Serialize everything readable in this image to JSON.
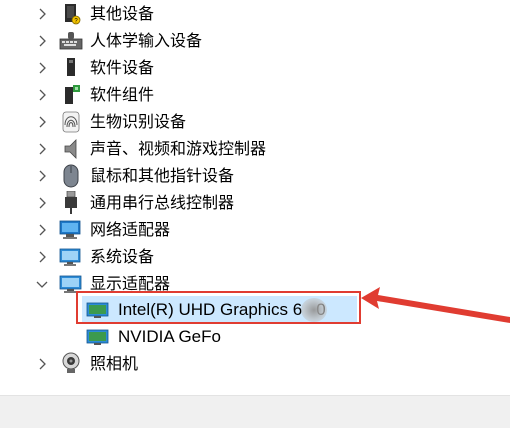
{
  "tree": {
    "items": [
      {
        "label": "其他设备",
        "icon": "unknown-device-icon",
        "expanded": false
      },
      {
        "label": "人体学输入设备",
        "icon": "keyboard-hid-icon",
        "expanded": false
      },
      {
        "label": "软件设备",
        "icon": "software-device-icon",
        "expanded": false
      },
      {
        "label": "软件组件",
        "icon": "software-component-icon",
        "expanded": false
      },
      {
        "label": "生物识别设备",
        "icon": "fingerprint-icon",
        "expanded": false
      },
      {
        "label": "声音、视频和游戏控制器",
        "icon": "speaker-icon",
        "expanded": false
      },
      {
        "label": "鼠标和其他指针设备",
        "icon": "mouse-icon",
        "expanded": false
      },
      {
        "label": "通用串行总线控制器",
        "icon": "usb-icon",
        "expanded": false
      },
      {
        "label": "网络适配器",
        "icon": "network-adapter-icon",
        "expanded": false
      },
      {
        "label": "系统设备",
        "icon": "system-device-icon",
        "expanded": false
      },
      {
        "label": "显示适配器",
        "icon": "display-adapter-icon",
        "expanded": true
      },
      {
        "label": "照相机",
        "icon": "camera-icon",
        "expanded": false
      }
    ],
    "display_children": [
      {
        "label": "Intel(R) UHD Graphics 6",
        "tail": "0",
        "icon": "monitor-icon",
        "selected": true
      },
      {
        "label": "NVIDIA GeFo",
        "icon": "monitor-icon",
        "selected": false
      }
    ]
  },
  "colors": {
    "selection": "#cce8ff",
    "highlight_border": "#e03c31",
    "status_bar": "#f0f0f0"
  }
}
